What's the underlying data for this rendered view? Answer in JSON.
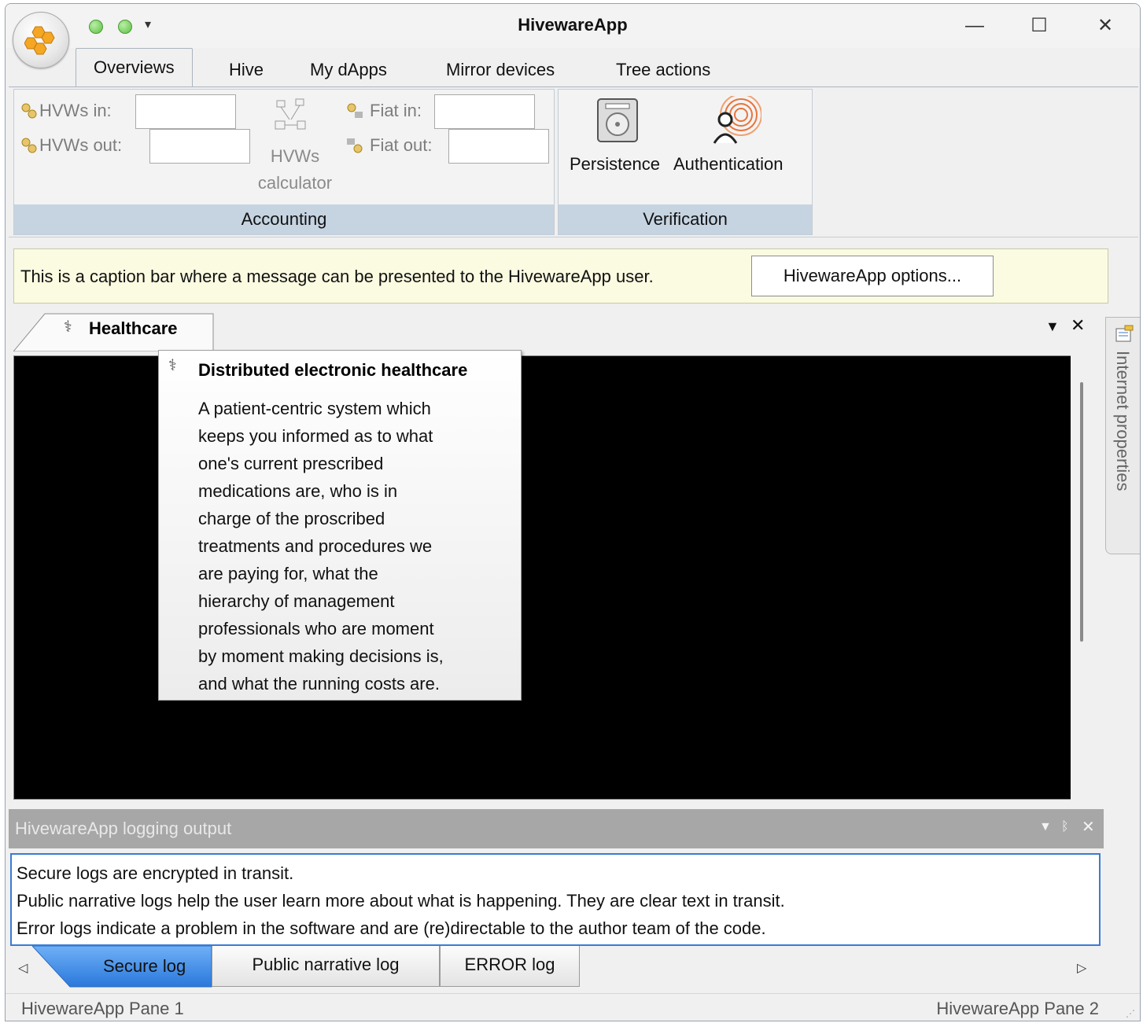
{
  "window": {
    "title": "HivewareApp",
    "controls": {
      "minimize": "—",
      "maximize": "☐",
      "close": "✕"
    },
    "quick_access_more": "▾"
  },
  "ribbon": {
    "tabs": [
      {
        "label": "Overviews",
        "active": true
      },
      {
        "label": "Hive",
        "active": false
      },
      {
        "label": "My dApps",
        "active": false
      },
      {
        "label": "Mirror devices",
        "active": false
      },
      {
        "label": "Tree actions",
        "active": false
      }
    ],
    "accounting": {
      "caption": "Accounting",
      "hvws_in_label": "HVWs in:",
      "hvws_in_value": "",
      "hvws_out_label": "HVWs out:",
      "hvws_out_value": "",
      "calculator_label_1": "HVWs",
      "calculator_label_2": "calculator",
      "fiat_in_label": "Fiat in:",
      "fiat_in_value": "",
      "fiat_out_label": "Fiat out:",
      "fiat_out_value": ""
    },
    "verification": {
      "caption": "Verification",
      "persistence_label": "Persistence",
      "authentication_label": "Authentication"
    }
  },
  "caption_bar": {
    "message": "This is a caption bar where a message can be presented to the HivewareApp user.",
    "button_label": "HivewareApp options..."
  },
  "document": {
    "tab_label": "Healthcare",
    "dropdown_glyph": "▼",
    "close_glyph": "✕"
  },
  "side_panel": {
    "label": "Internet properties"
  },
  "tooltip": {
    "title": "Distributed electronic healthcare",
    "lines": [
      "A patient-centric system which",
      "keeps you informed as to what",
      "one's current prescribed",
      "medications are, who is in",
      "charge of the proscribed",
      "treatments and procedures we",
      "are paying for, what the",
      "hierarchy of management",
      "professionals who are moment",
      "by moment making decisions is,",
      "and what the running costs are."
    ]
  },
  "logging": {
    "title": "HivewareApp logging output",
    "lines": [
      "Secure logs are encrypted in transit.",
      "Public narrative logs help the user learn more about what is happening. They are clear text in transit.",
      "Error logs indicate a problem in the software and are (re)directable to the author team of the code."
    ],
    "tabs": [
      {
        "label": "Secure log",
        "active": true
      },
      {
        "label": "Public narrative log",
        "active": false
      },
      {
        "label": "ERROR log",
        "active": false
      }
    ]
  },
  "status_bar": {
    "pane_1": "HivewareApp Pane 1",
    "pane_2": "HivewareApp Pane 2"
  },
  "colors": {
    "accent_blue": "#3a7bd5",
    "ribbon_caption": "#c6d4e2",
    "caption_bar_bg": "#fbfbe2",
    "doc_area": "#000000"
  }
}
